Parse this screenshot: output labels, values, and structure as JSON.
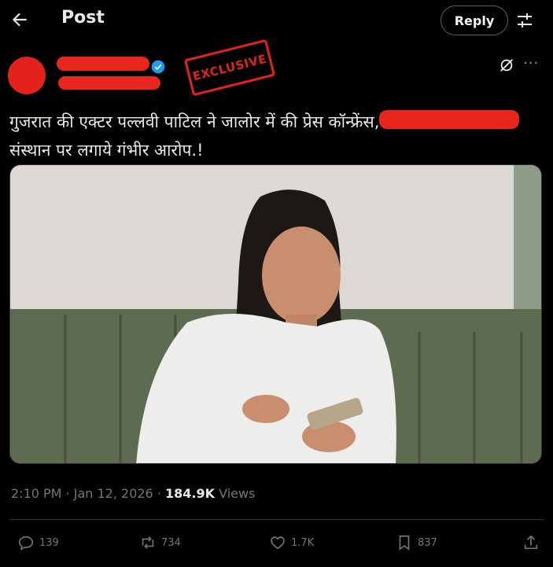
{
  "header": {
    "title": "Post",
    "reply_label": "Reply",
    "back_icon": "arrow-left-icon",
    "tune_icon": "sliders-icon"
  },
  "author": {
    "stamp_text": "EXCLUSIVE",
    "verified_icon": "verified-badge-icon",
    "colors": {
      "redaction": "#e8261e",
      "verified": "#1d9bf0"
    }
  },
  "post": {
    "text_line1": "गुजरात की एक्टर पल्लवी पाटिल ने जालोर में की प्रेस कॉन्फ्रेंस,",
    "text_line2": "संस्थान पर लगाये गंभीर आरोप.!"
  },
  "meta": {
    "time": "2:10 PM",
    "date": "Jan 12, 2026",
    "views_count": "184.9K",
    "views_label": "Views"
  },
  "actions": {
    "replies": "139",
    "reposts": "734",
    "likes": "1.7K",
    "bookmarks": "837"
  }
}
